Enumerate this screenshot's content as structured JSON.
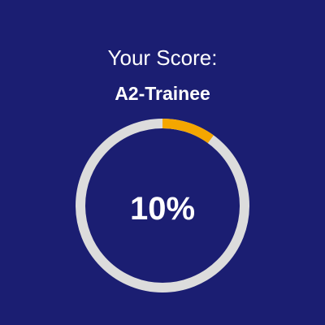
{
  "score": {
    "heading": "Your Score:",
    "level": "A2-Trainee",
    "percent_label": "10%",
    "progress": 0.1
  },
  "colors": {
    "background": "#1b1e72",
    "track": "#dcdcdc",
    "progress": "#f4a600",
    "text": "#ffffff"
  }
}
